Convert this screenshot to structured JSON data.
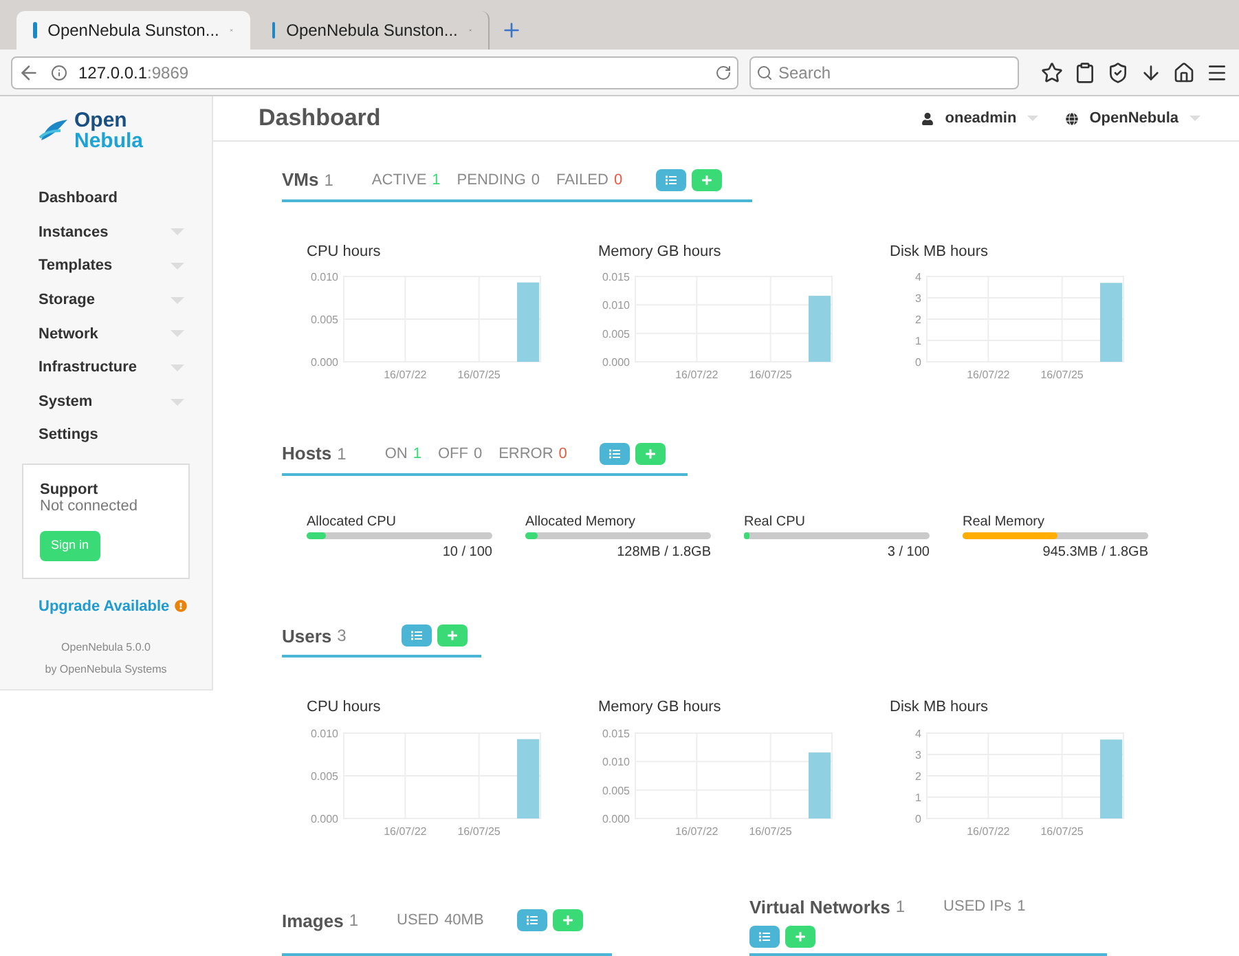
{
  "browser": {
    "tabs": [
      {
        "title": "OpenNebula Sunston...",
        "selected": true
      },
      {
        "title": "OpenNebula Sunston...",
        "selected": false
      }
    ],
    "address": {
      "host": "127.0.0.1",
      "port": ":9869"
    },
    "search": {
      "placeholder": "Search"
    }
  },
  "header": {
    "logo": {
      "line1": "Open",
      "line2": "Nebula"
    },
    "page_title": "Dashboard",
    "user": "oneadmin",
    "zone": "OpenNebula"
  },
  "sidebar": {
    "items": [
      {
        "label": "Dashboard",
        "expandable": false
      },
      {
        "label": "Instances",
        "expandable": true
      },
      {
        "label": "Templates",
        "expandable": true
      },
      {
        "label": "Storage",
        "expandable": true
      },
      {
        "label": "Network",
        "expandable": true
      },
      {
        "label": "Infrastructure",
        "expandable": true
      },
      {
        "label": "System",
        "expandable": true
      },
      {
        "label": "Settings",
        "expandable": false
      }
    ],
    "support": {
      "title": "Support",
      "status": "Not connected",
      "button": "Sign in"
    },
    "upgrade": "Upgrade Available",
    "version": "OpenNebula 5.0.0",
    "vendor": "by OpenNebula Systems"
  },
  "vms": {
    "title": "VMs",
    "count": "1",
    "stats": [
      {
        "label": "ACTIVE",
        "value": "1",
        "color": "#3adb76"
      },
      {
        "label": "PENDING",
        "value": "0",
        "color": "#8a8a8a"
      },
      {
        "label": "FAILED",
        "value": "0",
        "color": "#ec5840"
      }
    ],
    "charts": [
      {
        "chart_data": {
          "type": "bar",
          "title": "CPU hours",
          "grid": true,
          "categories": [
            null,
            null,
            "16/07/22",
            null,
            null,
            "16/07/25",
            null,
            null
          ],
          "values": [
            null,
            null,
            null,
            null,
            null,
            null,
            null,
            0.0093
          ],
          "ylim": [
            0,
            0.01
          ],
          "yticks": [
            {
              "value": 0,
              "label": "0.000"
            },
            {
              "value": 0.005,
              "label": "0.005"
            },
            {
              "value": 0.01,
              "label": "0.010"
            }
          ]
        }
      },
      {
        "chart_data": {
          "type": "bar",
          "title": "Memory GB hours",
          "grid": true,
          "categories": [
            null,
            null,
            "16/07/22",
            null,
            null,
            "16/07/25",
            null,
            null
          ],
          "values": [
            null,
            null,
            null,
            null,
            null,
            null,
            null,
            0.0116
          ],
          "ylim": [
            0,
            0.015
          ],
          "yticks": [
            {
              "value": 0,
              "label": "0.000"
            },
            {
              "value": 0.005,
              "label": "0.005"
            },
            {
              "value": 0.01,
              "label": "0.010"
            },
            {
              "value": 0.015,
              "label": "0.015"
            }
          ]
        }
      },
      {
        "chart_data": {
          "type": "bar",
          "title": "Disk MB hours",
          "grid": true,
          "categories": [
            null,
            null,
            "16/07/22",
            null,
            null,
            "16/07/25",
            null,
            null
          ],
          "values": [
            null,
            null,
            null,
            null,
            null,
            null,
            null,
            3.7
          ],
          "ylim": [
            0,
            4
          ],
          "yticks": [
            0,
            1,
            2,
            3,
            4
          ]
        }
      }
    ]
  },
  "hosts": {
    "title": "Hosts",
    "count": "1",
    "stats": [
      {
        "label": "ON",
        "value": "1",
        "color": "#3adb76"
      },
      {
        "label": "OFF",
        "value": "0",
        "color": "#8a8a8a"
      },
      {
        "label": "ERROR",
        "value": "0",
        "color": "#ec5840"
      }
    ],
    "meters": [
      {
        "label": "Allocated CPU",
        "level": 0.1,
        "reading": "10 / 100",
        "color": "#3adb76"
      },
      {
        "label": "Allocated Memory",
        "level": 0.07,
        "reading": "128MB / 1.8GB",
        "color": "#3adb76"
      },
      {
        "label": "Real CPU",
        "level": 0.03,
        "reading": "3 / 100",
        "color": "#3adb76"
      },
      {
        "label": "Real Memory",
        "level": 0.51,
        "reading": "945.3MB / 1.8GB",
        "color": "#ffae00"
      }
    ]
  },
  "users": {
    "title": "Users",
    "count": "3",
    "charts": [
      {
        "chart_data": {
          "type": "bar",
          "title": "CPU hours",
          "grid": true,
          "categories": [
            null,
            null,
            "16/07/22",
            null,
            null,
            "16/07/25",
            null,
            null
          ],
          "values": [
            null,
            null,
            null,
            null,
            null,
            null,
            null,
            0.0093
          ],
          "ylim": [
            0,
            0.01
          ],
          "yticks": [
            {
              "value": 0,
              "label": "0.000"
            },
            {
              "value": 0.005,
              "label": "0.005"
            },
            {
              "value": 0.01,
              "label": "0.010"
            }
          ]
        }
      },
      {
        "chart_data": {
          "type": "bar",
          "title": "Memory GB hours",
          "grid": true,
          "categories": [
            null,
            null,
            "16/07/22",
            null,
            null,
            "16/07/25",
            null,
            null
          ],
          "values": [
            null,
            null,
            null,
            null,
            null,
            null,
            null,
            0.0116
          ],
          "ylim": [
            0,
            0.015
          ],
          "yticks": [
            {
              "value": 0,
              "label": "0.000"
            },
            {
              "value": 0.005,
              "label": "0.005"
            },
            {
              "value": 0.01,
              "label": "0.010"
            },
            {
              "value": 0.015,
              "label": "0.015"
            }
          ]
        }
      },
      {
        "chart_data": {
          "type": "bar",
          "title": "Disk MB hours",
          "grid": true,
          "categories": [
            null,
            null,
            "16/07/22",
            null,
            null,
            "16/07/25",
            null,
            null
          ],
          "values": [
            null,
            null,
            null,
            null,
            null,
            null,
            null,
            3.7
          ],
          "ylim": [
            0,
            4
          ],
          "yticks": [
            0,
            1,
            2,
            3,
            4
          ]
        }
      }
    ]
  },
  "images": {
    "title": "Images",
    "count": "1",
    "stats": [
      {
        "label": "USED",
        "value": "40MB",
        "color": "#8a8a8a"
      }
    ]
  },
  "virtual_networks": {
    "title": "Virtual Networks",
    "count": "1",
    "stats": [
      {
        "label": "USED IPs",
        "value": "1",
        "color": "#8a8a8a"
      }
    ]
  }
}
